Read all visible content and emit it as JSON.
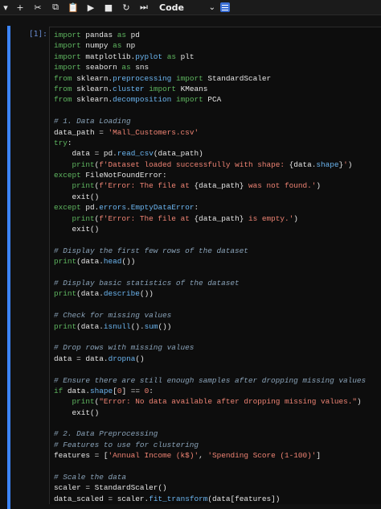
{
  "toolbar": {
    "buttons": [
      {
        "name": "save-icon",
        "glyph": "▾"
      },
      {
        "name": "add-cell-icon",
        "glyph": "+"
      },
      {
        "name": "cut-icon",
        "glyph": "✂"
      },
      {
        "name": "copy-icon",
        "glyph": "⧉"
      },
      {
        "name": "paste-icon",
        "glyph": "📋"
      },
      {
        "name": "run-icon",
        "glyph": "▶"
      },
      {
        "name": "stop-icon",
        "glyph": "■"
      },
      {
        "name": "restart-icon",
        "glyph": "↻"
      },
      {
        "name": "run-all-icon",
        "glyph": "⏭"
      }
    ],
    "cell_type": "Code"
  },
  "cell": {
    "prompt": "[1]:",
    "accent": "#3d86ff",
    "lines": [
      [
        [
          "kw",
          "import"
        ],
        [
          "t",
          " pandas "
        ],
        [
          "kw",
          "as"
        ],
        [
          "t",
          " pd"
        ]
      ],
      [
        [
          "kw",
          "import"
        ],
        [
          "t",
          " numpy "
        ],
        [
          "kw",
          "as"
        ],
        [
          "t",
          " np"
        ]
      ],
      [
        [
          "kw",
          "import"
        ],
        [
          "t",
          " matplotlib"
        ],
        [
          "op",
          "."
        ],
        [
          "fn",
          "pyplot"
        ],
        [
          "t",
          " "
        ],
        [
          "kw",
          "as"
        ],
        [
          "t",
          " plt"
        ]
      ],
      [
        [
          "kw",
          "import"
        ],
        [
          "t",
          " seaborn "
        ],
        [
          "kw",
          "as"
        ],
        [
          "t",
          " sns"
        ]
      ],
      [
        [
          "kw",
          "from"
        ],
        [
          "t",
          " sklearn"
        ],
        [
          "op",
          "."
        ],
        [
          "fn",
          "preprocessing"
        ],
        [
          "t",
          " "
        ],
        [
          "kw",
          "import"
        ],
        [
          "t",
          " StandardScaler"
        ]
      ],
      [
        [
          "kw",
          "from"
        ],
        [
          "t",
          " sklearn"
        ],
        [
          "op",
          "."
        ],
        [
          "fn",
          "cluster"
        ],
        [
          "t",
          " "
        ],
        [
          "kw",
          "import"
        ],
        [
          "t",
          " KMeans"
        ]
      ],
      [
        [
          "kw",
          "from"
        ],
        [
          "t",
          " sklearn"
        ],
        [
          "op",
          "."
        ],
        [
          "fn",
          "decomposition"
        ],
        [
          "t",
          " "
        ],
        [
          "kw",
          "import"
        ],
        [
          "t",
          " PCA"
        ]
      ],
      [],
      [
        [
          "cm",
          "# 1. Data Loading"
        ]
      ],
      [
        [
          "t",
          "data_path "
        ],
        [
          "op",
          "="
        ],
        [
          "t",
          " "
        ],
        [
          "st",
          "'Mall_Customers.csv'"
        ]
      ],
      [
        [
          "kw",
          "try"
        ],
        [
          "t",
          ":"
        ]
      ],
      [
        [
          "t",
          "    data "
        ],
        [
          "op",
          "="
        ],
        [
          "t",
          " pd"
        ],
        [
          "op",
          "."
        ],
        [
          "fn",
          "read_csv"
        ],
        [
          "t",
          "(data_path)"
        ]
      ],
      [
        [
          "t",
          "    "
        ],
        [
          "kw",
          "print"
        ],
        [
          "t",
          "("
        ],
        [
          "st",
          "f'Dataset loaded successfully with shape: "
        ],
        [
          "t",
          "{data"
        ],
        [
          "op",
          "."
        ],
        [
          "fn",
          "shape"
        ],
        [
          "t",
          "}"
        ],
        [
          "st",
          "'"
        ],
        [
          "t",
          ")"
        ]
      ],
      [
        [
          "kw",
          "except"
        ],
        [
          "t",
          " FileNotFoundError:"
        ]
      ],
      [
        [
          "t",
          "    "
        ],
        [
          "kw",
          "print"
        ],
        [
          "t",
          "("
        ],
        [
          "st",
          "f'Error: The file at "
        ],
        [
          "t",
          "{data_path}"
        ],
        [
          "st",
          " was not found.'"
        ],
        [
          "t",
          ")"
        ]
      ],
      [
        [
          "t",
          "    exit()"
        ]
      ],
      [
        [
          "kw",
          "except"
        ],
        [
          "t",
          " pd"
        ],
        [
          "op",
          "."
        ],
        [
          "fn",
          "errors"
        ],
        [
          "op",
          "."
        ],
        [
          "fn",
          "EmptyDataError"
        ],
        [
          "t",
          ":"
        ]
      ],
      [
        [
          "t",
          "    "
        ],
        [
          "kw",
          "print"
        ],
        [
          "t",
          "("
        ],
        [
          "st",
          "f'Error: The file at "
        ],
        [
          "t",
          "{data_path}"
        ],
        [
          "st",
          " is empty.'"
        ],
        [
          "t",
          ")"
        ]
      ],
      [
        [
          "t",
          "    exit()"
        ]
      ],
      [],
      [
        [
          "cm",
          "# Display the first few rows of the dataset"
        ]
      ],
      [
        [
          "kw",
          "print"
        ],
        [
          "t",
          "(data"
        ],
        [
          "op",
          "."
        ],
        [
          "fn",
          "head"
        ],
        [
          "t",
          "())"
        ]
      ],
      [],
      [
        [
          "cm",
          "# Display basic statistics of the dataset"
        ]
      ],
      [
        [
          "kw",
          "print"
        ],
        [
          "t",
          "(data"
        ],
        [
          "op",
          "."
        ],
        [
          "fn",
          "describe"
        ],
        [
          "t",
          "())"
        ]
      ],
      [],
      [
        [
          "cm",
          "# Check for missing values"
        ]
      ],
      [
        [
          "kw",
          "print"
        ],
        [
          "t",
          "(data"
        ],
        [
          "op",
          "."
        ],
        [
          "fn",
          "isnull"
        ],
        [
          "t",
          "()"
        ],
        [
          "op",
          "."
        ],
        [
          "fn",
          "sum"
        ],
        [
          "t",
          "())"
        ]
      ],
      [],
      [
        [
          "cm",
          "# Drop rows with missing values"
        ]
      ],
      [
        [
          "t",
          "data "
        ],
        [
          "op",
          "="
        ],
        [
          "t",
          " data"
        ],
        [
          "op",
          "."
        ],
        [
          "fn",
          "dropna"
        ],
        [
          "t",
          "()"
        ]
      ],
      [],
      [
        [
          "cm",
          "# Ensure there are still enough samples after dropping missing values"
        ]
      ],
      [
        [
          "kw",
          "if"
        ],
        [
          "t",
          " data"
        ],
        [
          "op",
          "."
        ],
        [
          "fn",
          "shape"
        ],
        [
          "t",
          "["
        ],
        [
          "st",
          "0"
        ],
        [
          "t",
          "] "
        ],
        [
          "op",
          "=="
        ],
        [
          "t",
          " "
        ],
        [
          "st",
          "0"
        ],
        [
          "t",
          ":"
        ]
      ],
      [
        [
          "t",
          "    "
        ],
        [
          "kw",
          "print"
        ],
        [
          "t",
          "("
        ],
        [
          "st",
          "\"Error: No data available after dropping missing values.\""
        ],
        [
          "t",
          ")"
        ]
      ],
      [
        [
          "t",
          "    exit()"
        ]
      ],
      [],
      [
        [
          "cm",
          "# 2. Data Preprocessing"
        ]
      ],
      [
        [
          "cm",
          "# Features to use for clustering"
        ]
      ],
      [
        [
          "t",
          "features "
        ],
        [
          "op",
          "="
        ],
        [
          "t",
          " ["
        ],
        [
          "st",
          "'Annual Income (k$)'"
        ],
        [
          "t",
          ", "
        ],
        [
          "st",
          "'Spending Score (1-100)'"
        ],
        [
          "t",
          "]"
        ]
      ],
      [],
      [
        [
          "cm",
          "# Scale the data"
        ]
      ],
      [
        [
          "t",
          "scaler "
        ],
        [
          "op",
          "="
        ],
        [
          "t",
          " StandardScaler()"
        ]
      ],
      [
        [
          "t",
          "data_scaled "
        ],
        [
          "op",
          "="
        ],
        [
          "t",
          " scaler"
        ],
        [
          "op",
          "."
        ],
        [
          "fn",
          "fit_transform"
        ],
        [
          "t",
          "(data[features])"
        ]
      ]
    ]
  }
}
